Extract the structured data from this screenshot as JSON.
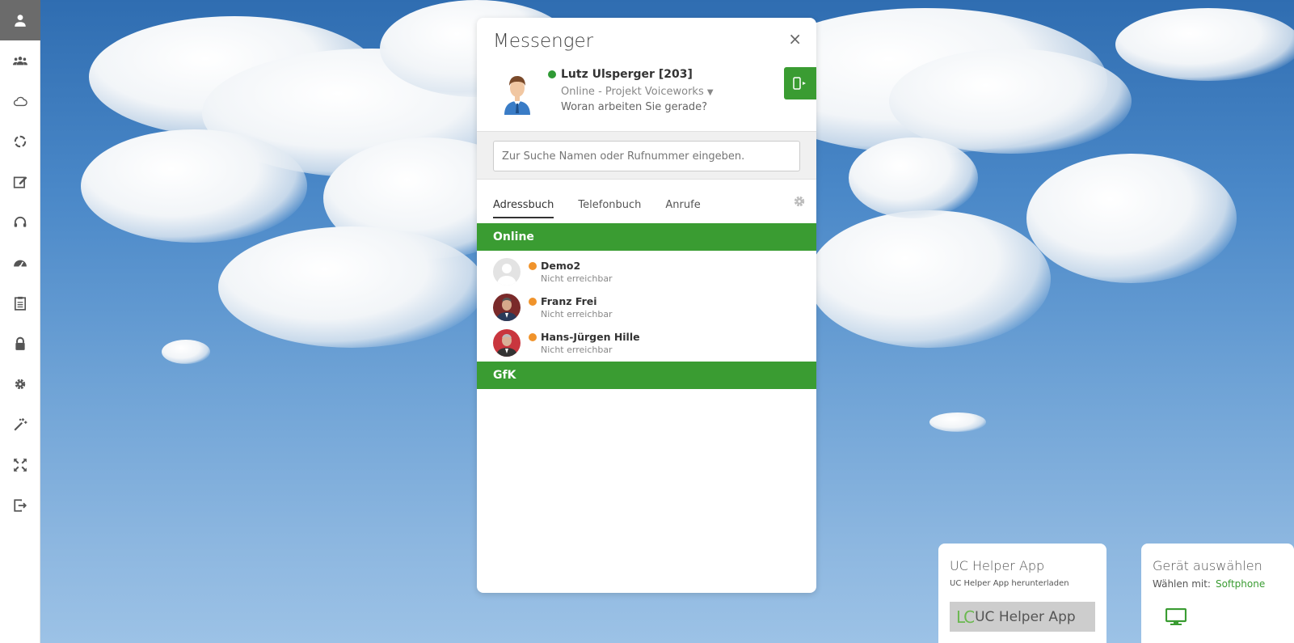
{
  "sidebar": {
    "items": [
      {
        "icon": "user-icon",
        "active": true
      },
      {
        "icon": "group-icon"
      },
      {
        "icon": "cloud-icon"
      },
      {
        "icon": "sync-icon"
      },
      {
        "icon": "edit-icon"
      },
      {
        "icon": "headset-icon"
      },
      {
        "icon": "dashboard-icon"
      },
      {
        "icon": "clipboard-icon"
      },
      {
        "icon": "lock-icon"
      },
      {
        "icon": "gear-icon"
      },
      {
        "icon": "magic-wand-icon"
      },
      {
        "icon": "fullscreen-icon"
      },
      {
        "icon": "logout-icon"
      }
    ]
  },
  "messenger": {
    "title": "Messenger",
    "close": "×",
    "user": {
      "name": "Lutz Ulsperger [203]",
      "status": "Online",
      "project": "- Projekt Voiceworks",
      "question": "Woran arbeiten Sie gerade?"
    },
    "search": {
      "placeholder": "Zur Suche Namen oder Rufnummer eingeben."
    },
    "tabs": [
      {
        "label": "Adressbuch",
        "active": true
      },
      {
        "label": "Telefonbuch"
      },
      {
        "label": "Anrufe"
      }
    ],
    "groups": [
      {
        "name": "Online",
        "contacts": [
          {
            "name": "Demo2",
            "status": "Nicht erreichbar"
          },
          {
            "name": "Franz Frei",
            "status": "Nicht erreichbar"
          },
          {
            "name": "Hans-Jürgen Hille",
            "status": "Nicht erreichbar"
          }
        ]
      },
      {
        "name": "GfK",
        "contacts": []
      }
    ]
  },
  "widgets": {
    "helper": {
      "title": "UC Helper App",
      "subtitle": "UC Helper App herunterladen",
      "logo": "LC",
      "button_label": "UC Helper App"
    },
    "device": {
      "title": "Gerät auswählen",
      "choose_label": "Wählen mit:",
      "choice": "Softphone"
    }
  },
  "colors": {
    "accent": "#3a9c32",
    "online": "#2f9a35",
    "away": "#f0932b"
  }
}
